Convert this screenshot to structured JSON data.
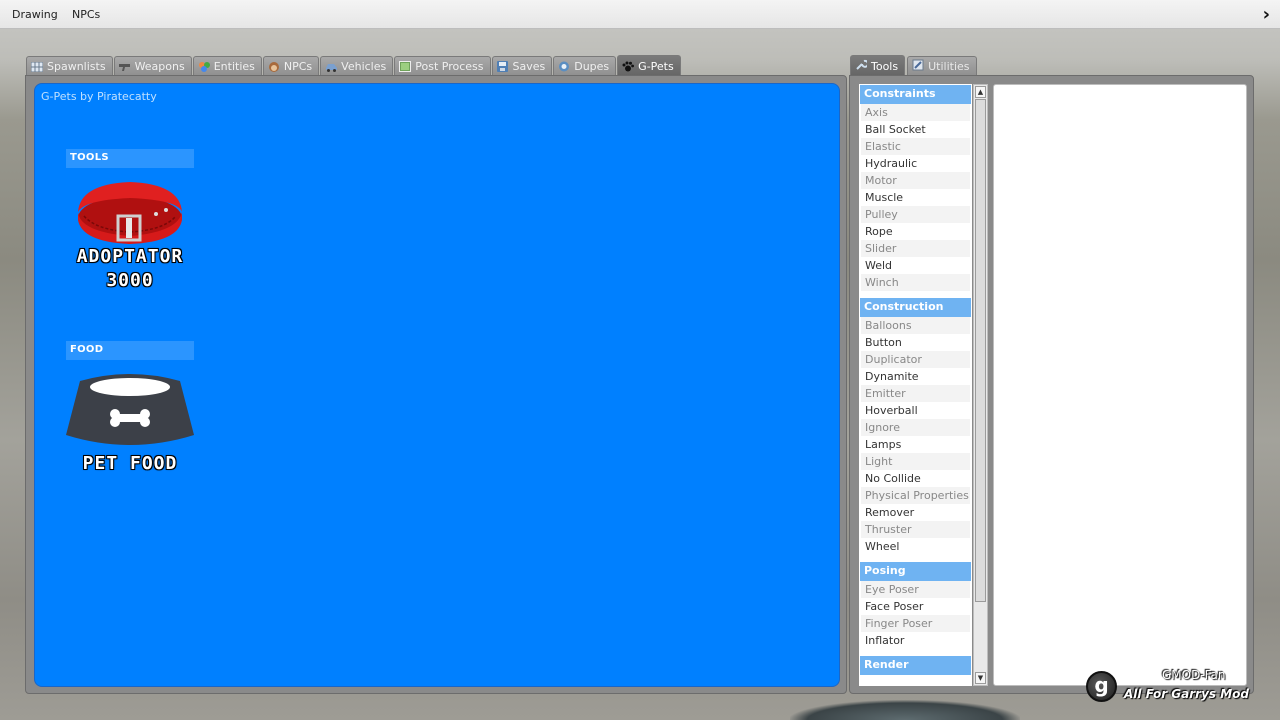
{
  "menubar": {
    "items": [
      "Drawing",
      "NPCs"
    ],
    "arrow": "›"
  },
  "spawnmenu": {
    "tabs": [
      {
        "label": "Spawnlists",
        "icon": "grid-icon"
      },
      {
        "label": "Weapons",
        "icon": "gun-icon"
      },
      {
        "label": "Entities",
        "icon": "bricks-icon"
      },
      {
        "label": "NPCs",
        "icon": "monkey-icon"
      },
      {
        "label": "Vehicles",
        "icon": "car-icon"
      },
      {
        "label": "Post Process",
        "icon": "image-icon"
      },
      {
        "label": "Saves",
        "icon": "disk-icon"
      },
      {
        "label": "Dupes",
        "icon": "dupe-icon"
      },
      {
        "label": "G-Pets",
        "icon": "paw-icon",
        "active": true
      }
    ],
    "background_color": "#0080ff",
    "credit": "G-Pets by Piratecatty",
    "categories": [
      {
        "header": "TOOLS",
        "item": {
          "caption_line1": "ADOPTATOR",
          "caption_line2": "3000",
          "icon": "red-collar-icon"
        }
      },
      {
        "header": "FOOD",
        "item": {
          "caption_line1": "PET FOOD",
          "caption_line2": "",
          "icon": "pet-bowl-icon"
        }
      }
    ]
  },
  "toolmenu": {
    "tabs": [
      {
        "label": "Tools",
        "icon": "wrench-icon",
        "active": true
      },
      {
        "label": "Utilities",
        "icon": "utilities-icon"
      }
    ],
    "sections": [
      {
        "title": "Constraints",
        "items": [
          "Axis",
          "Ball Socket",
          "Elastic",
          "Hydraulic",
          "Motor",
          "Muscle",
          "Pulley",
          "Rope",
          "Slider",
          "Weld",
          "Winch"
        ]
      },
      {
        "title": "Construction",
        "items": [
          "Balloons",
          "Button",
          "Duplicator",
          "Dynamite",
          "Emitter",
          "Hoverball",
          "Ignore",
          "Lamps",
          "Light",
          "No Collide",
          "Physical Properties",
          "Remover",
          "Thruster",
          "Wheel"
        ]
      },
      {
        "title": "Posing",
        "items": [
          "Eye Poser",
          "Face Poser",
          "Finger Poser",
          "Inflator"
        ]
      },
      {
        "title": "Render",
        "items": []
      }
    ]
  },
  "watermark": {
    "logo_letter": "g",
    "title": "GMOD-Fan",
    "subtitle": "All For Garrys Mod"
  }
}
